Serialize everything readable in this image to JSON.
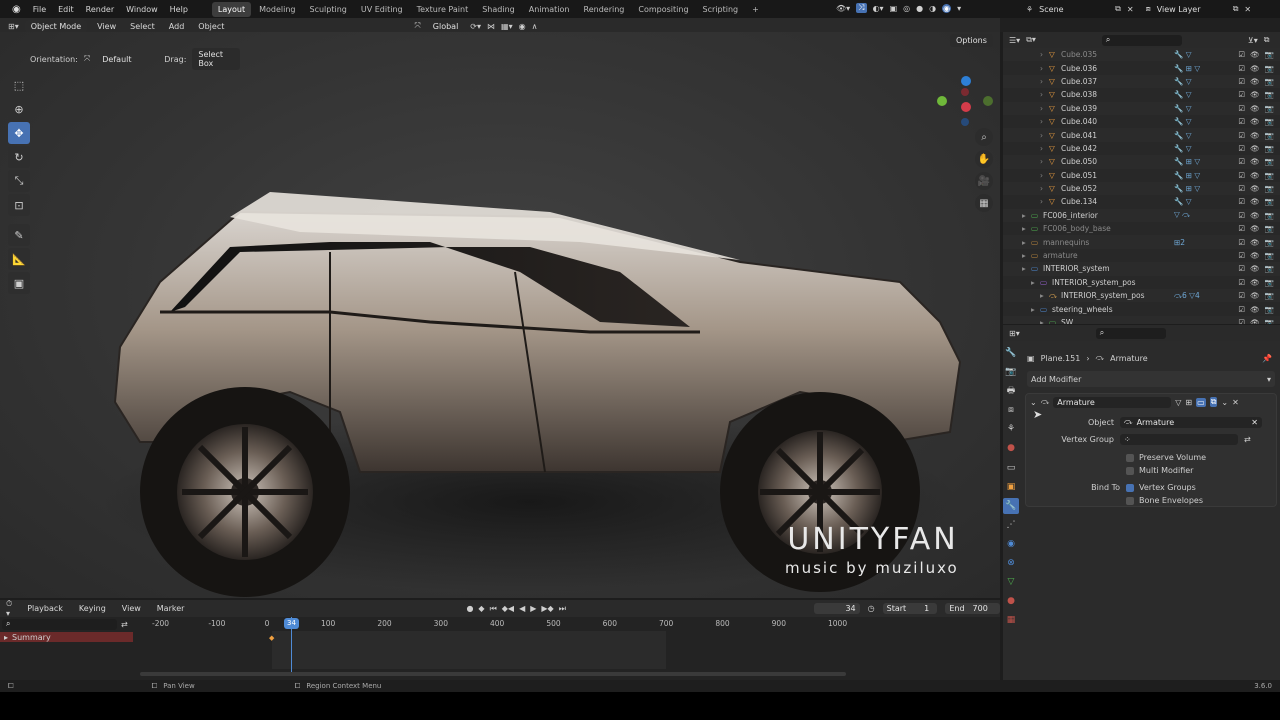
{
  "topbar": {
    "menus": [
      "File",
      "Edit",
      "Render",
      "Window",
      "Help"
    ],
    "workspaces": [
      "Layout",
      "Modeling",
      "Sculpting",
      "UV Editing",
      "Texture Paint",
      "Shading",
      "Animation",
      "Rendering",
      "Compositing",
      "Scripting"
    ],
    "active_workspace": "Layout",
    "add_workspace": "+",
    "scene_label": "Scene",
    "view_layer_label": "View Layer"
  },
  "viewport": {
    "mode": "Object Mode",
    "menus": [
      "View",
      "Select",
      "Add",
      "Object"
    ],
    "transform_orientation": "Global",
    "orientation_label": "Orientation:",
    "orientation_value": "Default",
    "drag_label": "Drag:",
    "drag_value": "Select Box",
    "options_label": "Options",
    "watermark_title": "UNITYFAN",
    "watermark_subtitle": "music by muziluxo"
  },
  "outliner": {
    "rows": [
      {
        "name": "Cube.035",
        "indent": 3,
        "type": "mesh",
        "faded": true,
        "mods": "🔧 ▽"
      },
      {
        "name": "Cube.036",
        "indent": 3,
        "type": "mesh",
        "mods": "🔧 ⊞ ▽"
      },
      {
        "name": "Cube.037",
        "indent": 3,
        "type": "mesh",
        "mods": "🔧 ▽"
      },
      {
        "name": "Cube.038",
        "indent": 3,
        "type": "mesh",
        "mods": "🔧 ▽"
      },
      {
        "name": "Cube.039",
        "indent": 3,
        "type": "mesh",
        "mods": "🔧 ▽"
      },
      {
        "name": "Cube.040",
        "indent": 3,
        "type": "mesh",
        "mods": "🔧 ▽"
      },
      {
        "name": "Cube.041",
        "indent": 3,
        "type": "mesh",
        "mods": "🔧 ▽"
      },
      {
        "name": "Cube.042",
        "indent": 3,
        "type": "mesh",
        "mods": "🔧 ▽"
      },
      {
        "name": "Cube.050",
        "indent": 3,
        "type": "mesh",
        "mods": "🔧 ⊞ ▽"
      },
      {
        "name": "Cube.051",
        "indent": 3,
        "type": "mesh",
        "mods": "🔧 ⊞ ▽"
      },
      {
        "name": "Cube.052",
        "indent": 3,
        "type": "mesh",
        "mods": "🔧 ⊞ ▽"
      },
      {
        "name": "Cube.134",
        "indent": 3,
        "type": "mesh",
        "mods": "🔧 ▽"
      },
      {
        "name": "FC006_interior",
        "indent": 1,
        "type": "collection-green",
        "mods": "▽ ⤼"
      },
      {
        "name": "FC006_body_base",
        "indent": 1,
        "type": "collection-green",
        "faded": true,
        "mods": ""
      },
      {
        "name": "mannequins",
        "indent": 1,
        "type": "collection-orange",
        "faded": true,
        "mods": "⊞2"
      },
      {
        "name": "armature",
        "indent": 1,
        "type": "collection-orange",
        "faded": true,
        "mods": ""
      },
      {
        "name": "INTERIOR_system",
        "indent": 1,
        "type": "collection-blue",
        "mods": ""
      },
      {
        "name": "INTERIOR_system_pos",
        "indent": 2,
        "type": "collection-purple",
        "mods": ""
      },
      {
        "name": "INTERIOR_system_pos",
        "indent": 3,
        "type": "armature",
        "mods": "⤼6 ▽4"
      },
      {
        "name": "steering_wheels",
        "indent": 2,
        "type": "collection-blue",
        "mods": ""
      },
      {
        "name": "SW",
        "indent": 3,
        "type": "collection-green",
        "mods": ""
      }
    ]
  },
  "properties": {
    "breadcrumb_object": "Plane.151",
    "breadcrumb_modifier": "Armature",
    "add_modifier": "Add Modifier",
    "modifier_name": "Armature",
    "object_label": "Object",
    "object_value": "Armature",
    "vertex_group_label": "Vertex Group",
    "preserve_volume": "Preserve Volume",
    "multi_modifier": "Multi Modifier",
    "bind_to_label": "Bind To",
    "vertex_groups": "Vertex Groups",
    "bone_envelopes": "Bone Envelopes"
  },
  "timeline": {
    "menus": [
      "Playback",
      "Keying",
      "View",
      "Marker"
    ],
    "current_frame": "34",
    "start_label": "Start",
    "start_value": "1",
    "end_label": "End",
    "end_value": "700",
    "ticks": [
      "-200",
      "-100",
      "0",
      "100",
      "200",
      "300",
      "400",
      "500",
      "600",
      "700",
      "800",
      "900",
      "1000"
    ],
    "summary_label": "Summary"
  },
  "statusbar": {
    "pan_view": "Pan View",
    "region_context": "Region Context Menu",
    "version": "3.6.0"
  },
  "colors": {
    "accent": "#4772b3",
    "mesh_icon": "#f0a040",
    "collection_green": "#4fb04f",
    "playhead": "#4f8bd6"
  }
}
